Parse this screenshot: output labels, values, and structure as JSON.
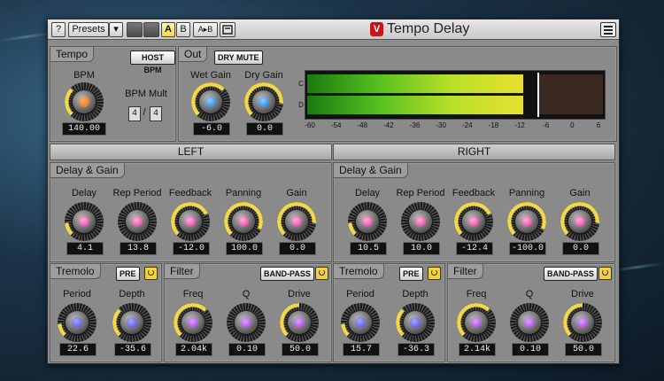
{
  "app": {
    "title": "Tempo Delay",
    "logo_letter": "V",
    "help_label": "?",
    "presets_label": "Presets",
    "dropdown_arrow": "▾",
    "compare_a": "A",
    "compare_b": "B",
    "copy_ab": "A▸B",
    "accent_color": "#f0d84a"
  },
  "tempo": {
    "title": "Tempo",
    "host_bpm": "HOST BPM",
    "bpm_label": "BPM",
    "bpm_value": "140.00",
    "mult_label": "BPM Mult",
    "mult_num": "4",
    "mult_sep": "/",
    "mult_den": "4"
  },
  "out": {
    "title": "Out",
    "dry_mute": "DRY MUTE",
    "wet_label": "Wet Gain",
    "wet_value": "-6.0",
    "dry_label": "Dry Gain",
    "dry_value": "0.0"
  },
  "meter": {
    "channel_top": "C",
    "channel_bottom": "D",
    "scale": [
      "-60",
      "-54",
      "-48",
      "-42",
      "-36",
      "-30",
      "-24",
      "-18",
      "-12",
      "-6",
      "0",
      "6"
    ],
    "level_db": -12
  },
  "channels": [
    {
      "header": "LEFT",
      "delay_gain": {
        "title": "Delay & Gain",
        "delay": {
          "label": "Delay",
          "value": "4.1"
        },
        "rep": {
          "label": "Rep Period",
          "value": "13.8"
        },
        "feedback": {
          "label": "Feedback",
          "value": "-12.0"
        },
        "panning": {
          "label": "Panning",
          "value": "100.0"
        },
        "gain": {
          "label": "Gain",
          "value": "0.0"
        }
      },
      "tremolo": {
        "title": "Tremolo",
        "pre": "PRE",
        "period": {
          "label": "Period",
          "value": "22.6"
        },
        "depth": {
          "label": "Depth",
          "value": "-35.6"
        }
      },
      "filter": {
        "title": "Filter",
        "mode": "BAND-PASS",
        "freq": {
          "label": "Freq",
          "value": "2.04k"
        },
        "q": {
          "label": "Q",
          "value": "0.10"
        },
        "drive": {
          "label": "Drive",
          "value": "50.0"
        }
      }
    },
    {
      "header": "RIGHT",
      "delay_gain": {
        "title": "Delay & Gain",
        "delay": {
          "label": "Delay",
          "value": "10.5"
        },
        "rep": {
          "label": "Rep Period",
          "value": "10.0"
        },
        "feedback": {
          "label": "Feedback",
          "value": "-12.4"
        },
        "panning": {
          "label": "Panning",
          "value": "-100.0"
        },
        "gain": {
          "label": "Gain",
          "value": "0.0"
        }
      },
      "tremolo": {
        "title": "Tremolo",
        "pre": "PRE",
        "period": {
          "label": "Period",
          "value": "15.7"
        },
        "depth": {
          "label": "Depth",
          "value": "-36.3"
        }
      },
      "filter": {
        "title": "Filter",
        "mode": "BAND-PASS",
        "freq": {
          "label": "Freq",
          "value": "2.14k"
        },
        "q": {
          "label": "Q",
          "value": "0.10"
        },
        "drive": {
          "label": "Drive",
          "value": "50.0"
        }
      }
    }
  ]
}
